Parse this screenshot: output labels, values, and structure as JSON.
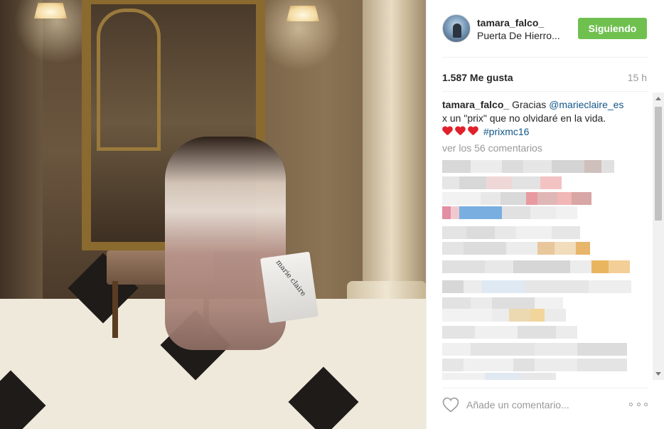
{
  "post": {
    "photo_alt": "",
    "bag_brand": "marie claire"
  },
  "header": {
    "username": "tamara_falco_",
    "location": "Puerta De Hierro...",
    "follow_label": "Siguiendo"
  },
  "stats": {
    "likes": "1.587 Me gusta",
    "time_ago": "15 h"
  },
  "caption": {
    "username": "tamara_falco_",
    "text_before": "Gracias",
    "mention": "@marieclaire_es",
    "text_after": "x un \"prix\" que no olvidaré en la vida.",
    "hashtag": "#prixmc16"
  },
  "comments": {
    "view_all": "ver los 56 comentarios"
  },
  "footer": {
    "comment_placeholder": "Añade un comentario..."
  },
  "colors": {
    "follow_button": "#70c050",
    "link": "#125688",
    "heart": "#e0202a"
  }
}
